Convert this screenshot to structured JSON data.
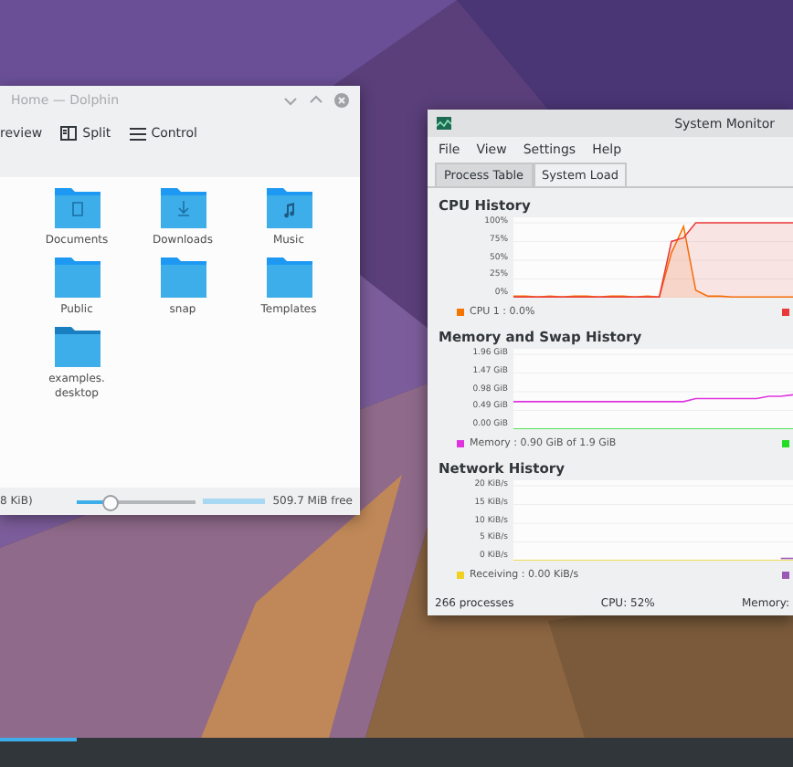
{
  "dolphin": {
    "title": "Home — Dolphin",
    "toolbar": [
      {
        "kind": "text",
        "label": "review"
      },
      {
        "kind": "split",
        "label": "Split"
      },
      {
        "kind": "menu",
        "label": "Control"
      }
    ],
    "files": [
      {
        "name": "Documents",
        "kind": "documents"
      },
      {
        "name": "Downloads",
        "kind": "downloads"
      },
      {
        "name": "Music",
        "kind": "music"
      },
      {
        "name": "Public",
        "kind": "folder"
      },
      {
        "name": "snap",
        "kind": "folder"
      },
      {
        "name": "Templates",
        "kind": "folder"
      },
      {
        "name": "examples.\ndesktop",
        "kind": "link"
      }
    ],
    "status": "8 KiB)",
    "zoom": {
      "level": 0.27
    },
    "disk": {
      "level": 1
    },
    "free_space": "509.7 MiB free"
  },
  "system_monitor": {
    "title": "System Monitor",
    "menu": [
      "File",
      "View",
      "Settings",
      "Help"
    ],
    "tabs": [
      {
        "label": "Process Table",
        "selected": false
      },
      {
        "label": "System Load",
        "selected": true
      }
    ],
    "sections": [
      {
        "title": "CPU History",
        "chart_data": {
          "type": "area",
          "grid": true,
          "ylim": [
            0,
            100
          ],
          "yticks": [
            {
              "value": 0,
              "label": "0%"
            },
            {
              "value": 25,
              "label": "25%"
            },
            {
              "value": 50,
              "label": "50%"
            },
            {
              "value": 75,
              "label": "75%"
            },
            {
              "value": 100,
              "label": "100%"
            }
          ],
          "series": [
            {
              "name": "CPU 1 : 0.0%",
              "color": "#f67400",
              "values": [
                2,
                2,
                1,
                2,
                1,
                2,
                2,
                1,
                2,
                2,
                1,
                2,
                1,
                60,
                95,
                10,
                2,
                2,
                1,
                1,
                1,
                1,
                1,
                1
              ]
            },
            {
              "color": "#e93a3a",
              "values": [
                1,
                1,
                1,
                1,
                1,
                1,
                1,
                1,
                1,
                1,
                1,
                1,
                1,
                75,
                80,
                100,
                100,
                100,
                100,
                100,
                100,
                100,
                100,
                100
              ]
            }
          ]
        }
      },
      {
        "title": "Memory and Swap History",
        "chart_data": {
          "type": "line",
          "grid": true,
          "ylim": [
            0,
            1.96
          ],
          "yticks": [
            {
              "value": 0,
              "label": "0.00 GiB"
            },
            {
              "value": 0.49,
              "label": "0.49 GiB"
            },
            {
              "value": 0.98,
              "label": "0.98 GiB"
            },
            {
              "value": 1.47,
              "label": "1.47 GiB"
            },
            {
              "value": 1.96,
              "label": "1.96 GiB"
            }
          ],
          "series": [
            {
              "name": "Memory : 0.90 GiB of 1.9 GiB",
              "color": "#e033e0",
              "values": [
                0.72,
                0.72,
                0.72,
                0.72,
                0.72,
                0.72,
                0.72,
                0.72,
                0.72,
                0.72,
                0.72,
                0.72,
                0.72,
                0.72,
                0.72,
                0.8,
                0.8,
                0.8,
                0.8,
                0.8,
                0.8,
                0.86,
                0.86,
                0.9
              ]
            },
            {
              "color": "#22dd22",
              "values": [
                0,
                0,
                0,
                0,
                0,
                0,
                0,
                0,
                0,
                0,
                0,
                0,
                0,
                0,
                0,
                0,
                0,
                0,
                0,
                0,
                0,
                0,
                0,
                0
              ]
            }
          ]
        }
      },
      {
        "title": "Network History",
        "chart_data": {
          "type": "line",
          "grid": true,
          "ylim": [
            0,
            20
          ],
          "yticks": [
            {
              "value": 0,
              "label": "0 KiB/s"
            },
            {
              "value": 5,
              "label": "5 KiB/s"
            },
            {
              "value": 10,
              "label": "10 KiB/s"
            },
            {
              "value": 15,
              "label": "15 KiB/s"
            },
            {
              "value": 20,
              "label": "20 KiB/s"
            }
          ],
          "series": [
            {
              "name": "Receiving : 0.00 KiB/s",
              "color": "#f0d020",
              "values": [
                0,
                0,
                0,
                0,
                0,
                0,
                0,
                0,
                0,
                0,
                0,
                0,
                0,
                0,
                0,
                0,
                0,
                0,
                0,
                0,
                0,
                0,
                0,
                0
              ]
            },
            {
              "color": "#9b59b6",
              "values": [
                null,
                null,
                null,
                null,
                null,
                null,
                null,
                null,
                null,
                null,
                null,
                null,
                null,
                null,
                null,
                null,
                null,
                null,
                null,
                null,
                null,
                null,
                0.6,
                0.6
              ]
            }
          ]
        }
      }
    ],
    "status": [
      "266 processes",
      "CPU: 52%",
      "Memory:"
    ]
  },
  "taskbar": {
    "active_indicator": true
  }
}
